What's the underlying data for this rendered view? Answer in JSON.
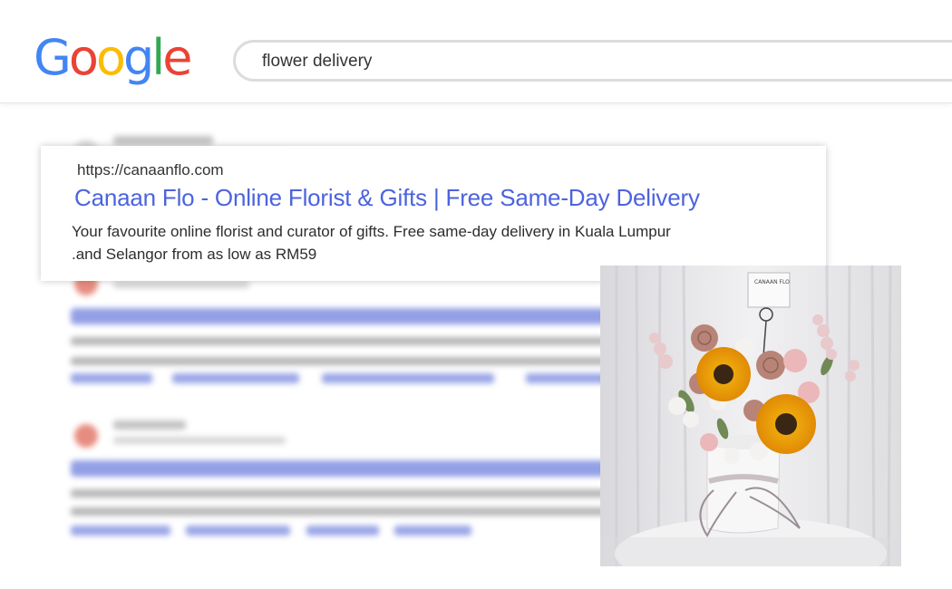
{
  "logo": {
    "letters": [
      "G",
      "o",
      "o",
      "g",
      "l",
      "e"
    ],
    "colors": [
      "#4285F4",
      "#EA4335",
      "#FBBC05",
      "#4285F4",
      "#34A853",
      "#EA4335"
    ]
  },
  "search": {
    "query": "flower delivery"
  },
  "featured_result": {
    "url": "https://canaanflo.com",
    "title": "Canaan Flo - Online Florist & Gifts | Free Same-Day Delivery",
    "description_line1": "Your favourite online florist and curator of gifts. Free same-day delivery in Kuala Lumpur",
    "description_line2": ".and Selangor from as low as RM59"
  },
  "photo": {
    "card_text": "CANAAN FLO",
    "icon": "flower-bouquet-image"
  },
  "colors": {
    "link": "#4c63de",
    "search_border": "#dcdcdc"
  }
}
